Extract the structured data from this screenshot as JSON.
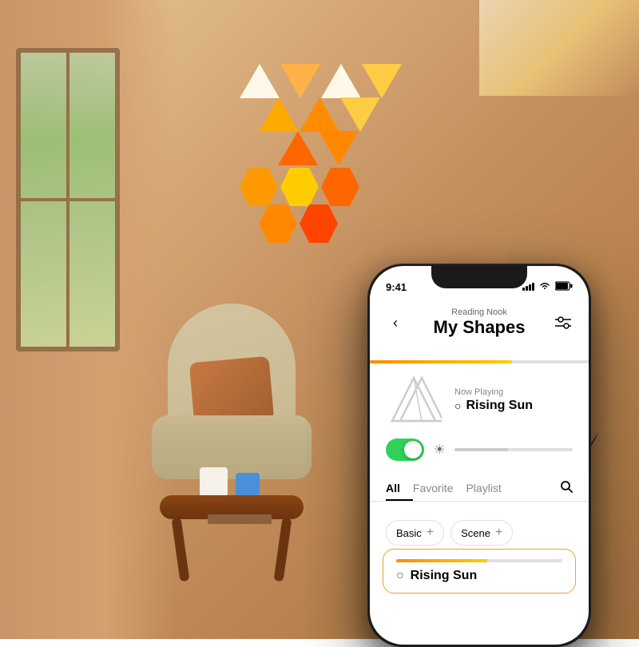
{
  "room": {
    "bg_color_start": "#e8c89a",
    "bg_color_end": "#a07040"
  },
  "status_bar": {
    "time": "9:41",
    "signal": "●●●●",
    "wifi": "wifi",
    "battery": "battery"
  },
  "header": {
    "location": "Reading Nook",
    "title": "My Shapes",
    "back_label": "‹",
    "filter_label": "⛭"
  },
  "progress_bar": {
    "fill_percent": 65
  },
  "now_playing": {
    "label": "Now Playing",
    "song_name": "Rising Sun",
    "sun_icon": "○"
  },
  "controls": {
    "toggle_on": true,
    "brightness_percent": 45
  },
  "tabs": [
    {
      "label": "All",
      "active": true
    },
    {
      "label": "Favorite",
      "active": false
    },
    {
      "label": "Playlist",
      "active": false
    }
  ],
  "chips": [
    {
      "label": "Basic",
      "has_plus": true
    },
    {
      "label": "Scene",
      "has_plus": true
    }
  ],
  "list_items": [
    {
      "title": "Rising Sun",
      "progress_percent": 55,
      "icon": "○",
      "selected": true
    }
  ]
}
